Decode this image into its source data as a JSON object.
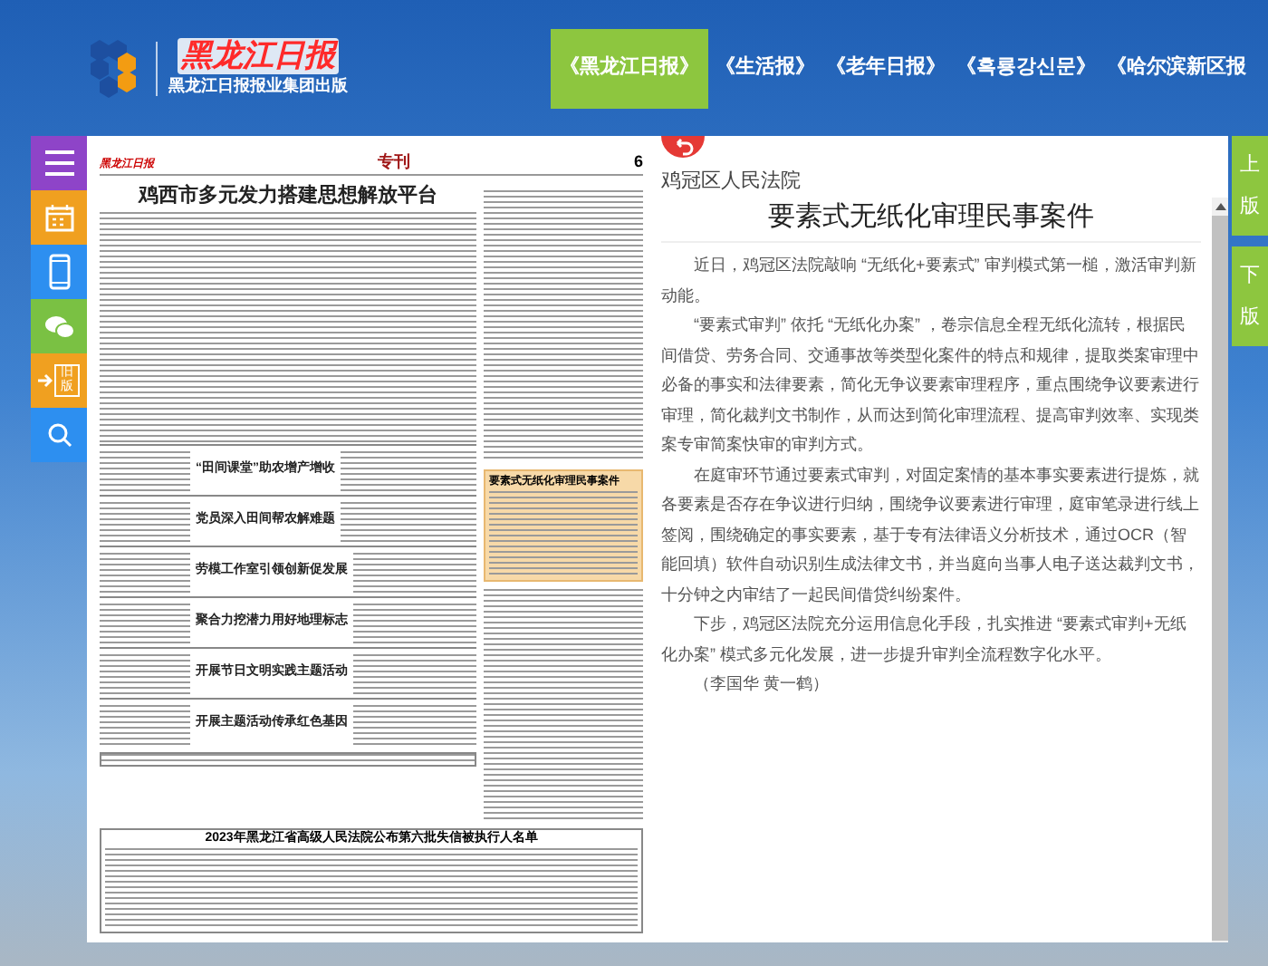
{
  "header": {
    "logo_title": "黑龙江日报",
    "logo_subtitle": "黑龙江日报报业集团出版"
  },
  "nav_tabs": [
    {
      "label": "《黑龙江日报》",
      "selected": true
    },
    {
      "label": "《生活报》",
      "selected": false
    },
    {
      "label": "《老年日报》",
      "selected": false
    },
    {
      "label": "《흑룡강신문》",
      "selected": false
    },
    {
      "label": "《哈尔滨新区报",
      "selected": false
    }
  ],
  "sidebar": [
    {
      "kind": "menu",
      "color": "#8e44c8"
    },
    {
      "kind": "calendar",
      "color": "#f0a020"
    },
    {
      "kind": "phone",
      "color": "#2d8ff0"
    },
    {
      "kind": "wechat",
      "color": "#7ac143"
    },
    {
      "kind": "old",
      "color": "#f0a020",
      "label": "旧版"
    },
    {
      "kind": "search",
      "color": "#2d8ff0"
    }
  ],
  "newspaper": {
    "masthead": "黑龙江日报",
    "section": "专刊",
    "page": "6",
    "title": "鸡西市多元发力搭建思想解放平台",
    "headlines": [
      "“田间课堂”助农增产增收",
      "党员深入田间帮农解难题",
      "劳模工作室引领创新促发展",
      "聚合力挖潜力用好地理标志",
      "开展节日文明实践主题活动",
      "开展主题活动传承红色基因"
    ],
    "right_articles": [
      {
        "title": "要素式无纸化审理民事案件",
        "selected": true
      }
    ],
    "table_title": "2023年黑龙江省高级人民法院公布第六批失信被执行人名单"
  },
  "article": {
    "source": "鸡冠区人民法院",
    "title": "要素式无纸化审理民事案件",
    "paragraphs": [
      "近日，鸡冠区法院敲响 “无纸化+要素式” 审判模式第一槌，激活审判新动能。",
      "“要素式审判” 依托 “无纸化办案” ，卷宗信息全程无纸化流转，根据民间借贷、劳务合同、交通事故等类型化案件的特点和规律，提取类案审理中必备的事实和法律要素，简化无争议要素审理程序，重点围绕争议要素进行审理，简化裁判文书制作，从而达到简化审理流程、提高审判效率、实现类案专审简案快审的审判方式。",
      "在庭审环节通过要素式审判，对固定案情的基本事实要素进行提炼，就各要素是否存在争议进行归纳，围绕争议要素进行审理，庭审笔录进行线上签阅，围绕确定的事实要素，基于专有法律语义分析技术，通过OCR（智能回填）软件自动识别生成法律文书，并当庭向当事人电子送达裁判文书，十分钟之内审结了一起民间借贷纠纷案件。",
      "下步，鸡冠区法院充分运用信息化手段，扎实推进 “要素式审判+无纸化办案” 模式多元化发展，进一步提升审判全流程数字化水平。",
      "（李国华 黄一鹤）"
    ]
  },
  "page_tabs": [
    {
      "top": "上",
      "bottom": "版"
    },
    {
      "top": "下",
      "bottom": "版"
    }
  ]
}
